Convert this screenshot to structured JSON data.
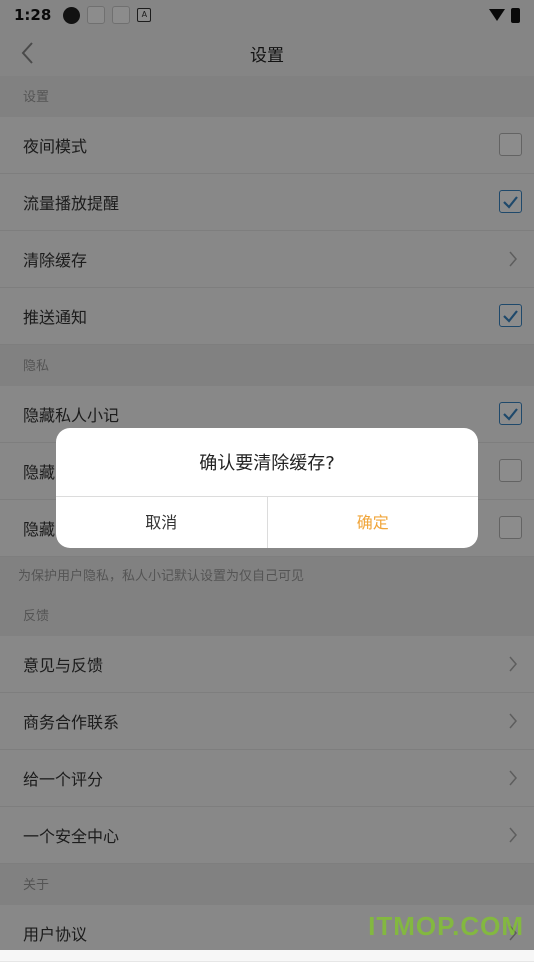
{
  "status_bar": {
    "time": "1:28",
    "notification_icon_label": "A"
  },
  "nav": {
    "title": "设置"
  },
  "sections": {
    "settings": {
      "title": "设置",
      "rows": [
        {
          "label": "夜间模式",
          "checked": false
        },
        {
          "label": "流量播放提醒",
          "checked": true
        },
        {
          "label": "清除缓存"
        },
        {
          "label": "推送通知",
          "checked": true
        }
      ]
    },
    "privacy": {
      "title": "隐私",
      "rows": [
        {
          "label": "隐藏私人小记",
          "checked": true
        },
        {
          "label": "隐藏",
          "checked": false
        },
        {
          "label": "隐藏",
          "checked": false
        }
      ],
      "note": "为保护用户隐私，私人小记默认设置为仅自己可见"
    },
    "feedback": {
      "title": "反馈",
      "rows": [
        {
          "label": "意见与反馈"
        },
        {
          "label": "商务合作联系"
        },
        {
          "label": "给一个评分"
        },
        {
          "label": "一个安全中心"
        }
      ]
    },
    "about": {
      "title": "关于",
      "rows": [
        {
          "label": "用户协议"
        }
      ]
    }
  },
  "dialog": {
    "message": "确认要清除缓存?",
    "cancel": "取消",
    "confirm": "确定"
  },
  "watermark": "ITMOP.COM",
  "colors": {
    "accent_check": "#3a86c4",
    "confirm_text": "#f0a53a"
  }
}
